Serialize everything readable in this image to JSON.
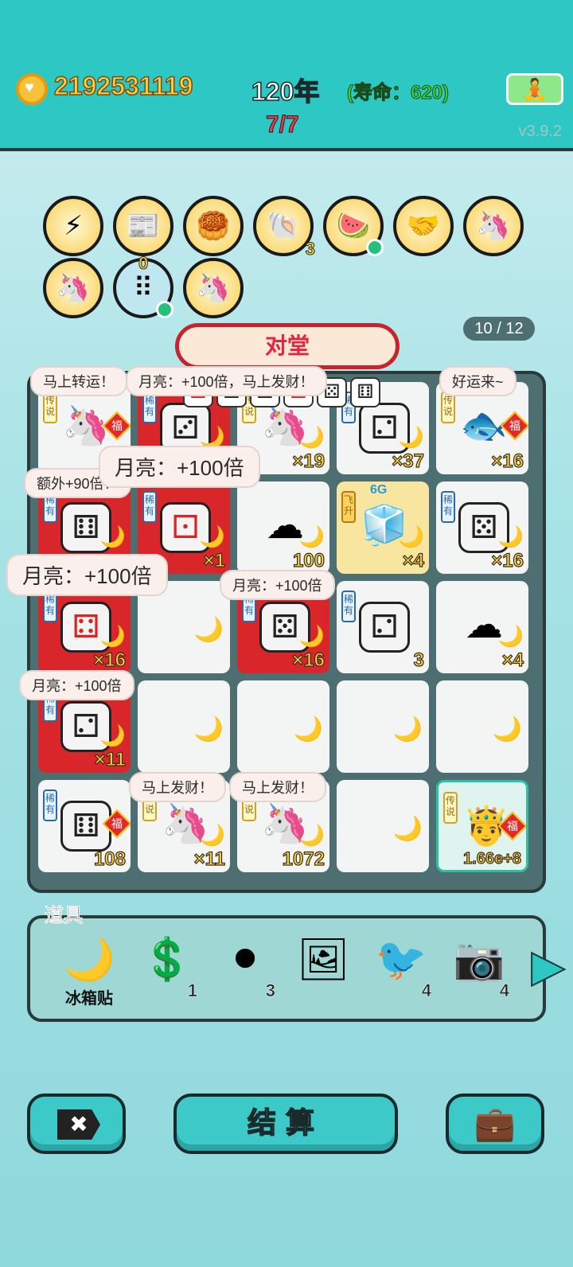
{
  "header": {
    "money": "2192531119",
    "year": "120年",
    "life": "(寿命：620)",
    "round": "7/7",
    "version": "v3.9.2"
  },
  "relics": [
    {
      "name": "lightning",
      "glyph": "⚡",
      "count": ""
    },
    {
      "name": "time-magazine",
      "glyph": "📰",
      "count": ""
    },
    {
      "name": "mooncake",
      "glyph": "🥮",
      "count": ""
    },
    {
      "name": "shell",
      "glyph": "🐚",
      "count": "3"
    },
    {
      "name": "fruit-basket",
      "glyph": "🍉",
      "count": ""
    },
    {
      "name": "handshake",
      "glyph": "🤝",
      "count": ""
    },
    {
      "name": "unicorn",
      "glyph": "🦄",
      "count": ""
    },
    {
      "name": "unicorn-2",
      "glyph": "🦄",
      "count": ""
    },
    {
      "name": "dice-box",
      "glyph": "⠿",
      "count": "0"
    },
    {
      "name": "unicorn-3",
      "glyph": "🦄",
      "count": ""
    }
  ],
  "banner": {
    "title": "对堂",
    "progress": "10 / 12"
  },
  "dicebar": [
    "⚀",
    "⚁",
    "⚂",
    "⚃",
    "⚄",
    "⚅"
  ],
  "bubbles": [
    "马上转运！",
    "月亮：+100倍，马上发财！",
    "好运来~",
    "月亮：+100倍",
    "额外+90倍！",
    "月亮：+100倍",
    "月亮：+100倍",
    "月亮：+100倍",
    "马上发财！",
    "马上发财！"
  ],
  "cells": [
    {
      "tag": "传说",
      "num": ""
    },
    {
      "tag": "稀有",
      "num": "30"
    },
    {
      "tag": "传说",
      "num": "×19"
    },
    {
      "tag": "稀有",
      "num": "×37"
    },
    {
      "tag": "传说",
      "num": "×16"
    },
    {
      "tag": "稀有",
      "num": ""
    },
    {
      "tag": "稀有",
      "num": "×1"
    },
    {
      "tag": "",
      "num": "100"
    },
    {
      "tag": "飞升",
      "num": "×4",
      "extra": "6G"
    },
    {
      "tag": "稀有",
      "num": "×16"
    },
    {
      "tag": "稀有",
      "num": "×16"
    },
    {
      "tag": "",
      "num": ""
    },
    {
      "tag": "稀有",
      "num": "×16"
    },
    {
      "tag": "稀有",
      "num": "3"
    },
    {
      "tag": "",
      "num": "×4"
    },
    {
      "tag": "稀有",
      "num": "×11"
    },
    {
      "tag": "",
      "num": ""
    },
    {
      "tag": "",
      "num": ""
    },
    {
      "tag": "",
      "num": ""
    },
    {
      "tag": "",
      "num": ""
    },
    {
      "tag": "稀有",
      "num": "108"
    },
    {
      "tag": "传说",
      "num": "×11"
    },
    {
      "tag": "传说",
      "num": "1072"
    },
    {
      "tag": "",
      "num": ""
    },
    {
      "tag": "传说",
      "num": "1.66e+8"
    }
  ],
  "props": {
    "title": "道具",
    "items": [
      {
        "glyph": "🌙",
        "count": "",
        "label": "冰箱贴"
      },
      {
        "glyph": "💲",
        "count": "1",
        "label": ""
      },
      {
        "glyph": "⚫",
        "count": "3",
        "label": ""
      },
      {
        "glyph": "🖼",
        "count": "",
        "label": ""
      },
      {
        "glyph": "🐦",
        "count": "4",
        "label": ""
      },
      {
        "glyph": "📷",
        "count": "4",
        "label": ""
      }
    ]
  },
  "buttons": {
    "settle": "结算",
    "close_glyph": "✖",
    "bag_glyph": "💼",
    "meditate_glyph": "🧘",
    "arrow_glyph": "▶"
  }
}
